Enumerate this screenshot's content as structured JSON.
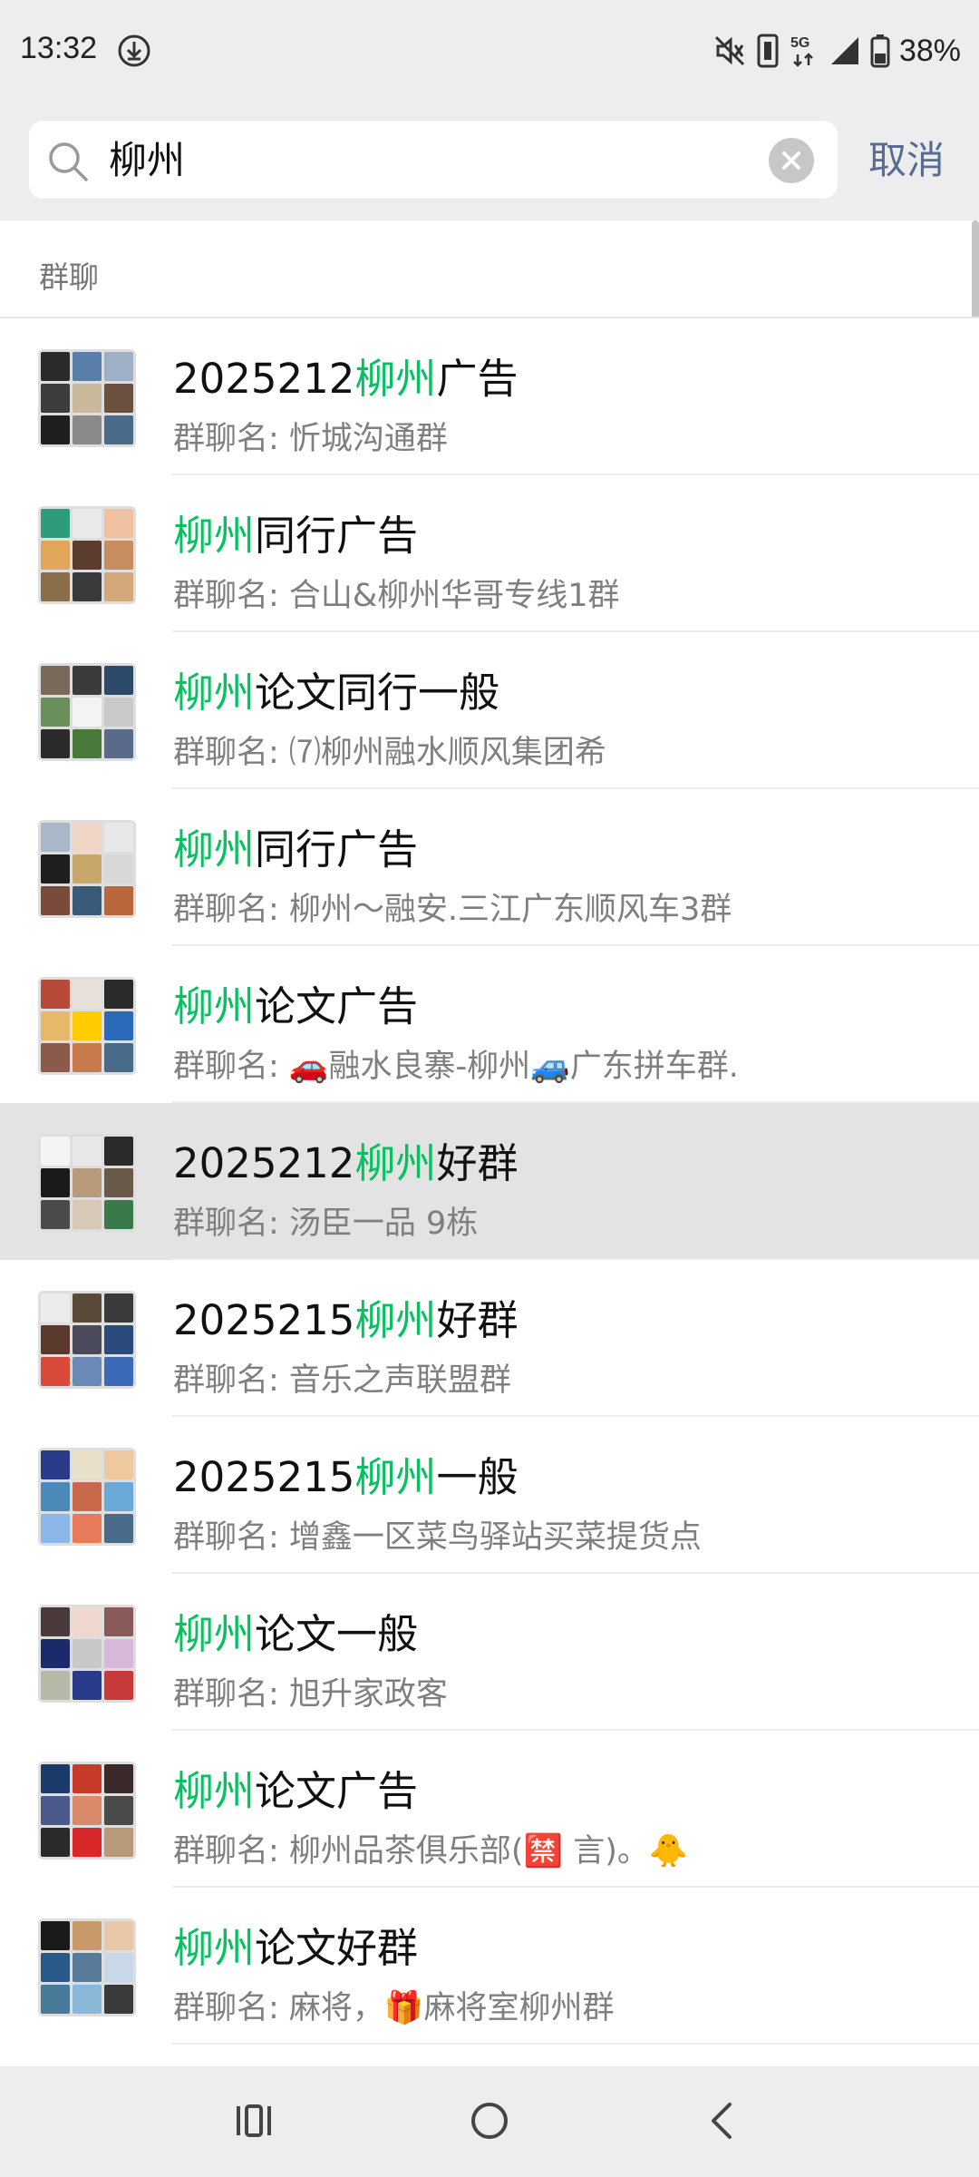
{
  "status_bar": {
    "time": "13:32",
    "battery": "38%",
    "network": "5G",
    "icons": [
      "download-icon",
      "mute-icon",
      "vibrate-icon",
      "5g-icon",
      "signal-icon",
      "battery-icon"
    ]
  },
  "search": {
    "query": "柳州",
    "cancel_label": "取消"
  },
  "section": {
    "title": "群聊"
  },
  "groups": [
    {
      "pre": "2025212",
      "hl": "柳州",
      "post": "广告",
      "sub": "群聊名: 忻城沟通群"
    },
    {
      "pre": "",
      "hl": "柳州",
      "post": "同行广告",
      "sub": "群聊名: 合山&柳州华哥专线1群"
    },
    {
      "pre": "",
      "hl": "柳州",
      "post": "论文同行一般",
      "sub": "群聊名: ⑺柳州融水顺风集团希"
    },
    {
      "pre": "",
      "hl": "柳州",
      "post": "同行广告",
      "sub": "群聊名: 柳州～融安.三江广东顺风车3群"
    },
    {
      "pre": "",
      "hl": "柳州",
      "post": "论文广告",
      "sub": "群聊名: 🚗融水良寨-柳州🚙广东拼车群."
    },
    {
      "pre": "2025212",
      "hl": "柳州",
      "post": "好群",
      "sub": "群聊名: 汤臣一品  9栋"
    },
    {
      "pre": "2025215",
      "hl": "柳州",
      "post": "好群",
      "sub": "群聊名: 音乐之声联盟群"
    },
    {
      "pre": "2025215",
      "hl": "柳州",
      "post": "一般",
      "sub": "群聊名: 增鑫一区菜鸟驿站买菜提货点"
    },
    {
      "pre": "",
      "hl": "柳州",
      "post": "论文一般",
      "sub": "群聊名: 旭升家政客"
    },
    {
      "pre": "",
      "hl": "柳州",
      "post": "论文广告",
      "sub": "群聊名: 柳州品茶俱乐部(🈲 言)。🐥"
    },
    {
      "pre": "",
      "hl": "柳州",
      "post": "论文好群",
      "sub": "群聊名: 麻将，🎁麻将室柳州群"
    }
  ],
  "colors": {
    "highlight": "#07c160",
    "cancel": "#576b95",
    "selected_row": "#e3e3e3"
  },
  "nav": [
    "recents-icon",
    "home-icon",
    "back-icon"
  ]
}
